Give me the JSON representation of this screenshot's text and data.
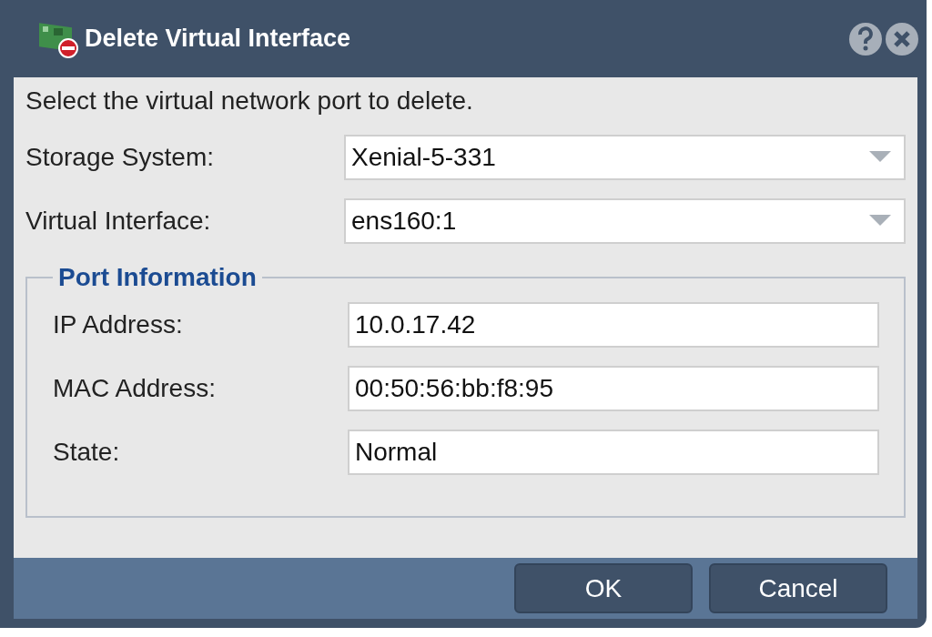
{
  "window": {
    "title": "Delete Virtual Interface"
  },
  "instruction": "Select the virtual network port to delete.",
  "fields": [
    {
      "label": "Storage System:",
      "value": "Xenial-5-331",
      "kind": "dropdown"
    },
    {
      "label": "Virtual Interface:",
      "value": "ens160:1",
      "kind": "dropdown"
    }
  ],
  "port_information": {
    "legend": "Port Information",
    "fields": [
      {
        "label": "IP Address:",
        "value": "10.0.17.42",
        "kind": "text"
      },
      {
        "label": "MAC Address:",
        "value": "00:50:56:bb:f8:95",
        "kind": "text"
      },
      {
        "label": "State:",
        "value": "Normal",
        "kind": "text"
      }
    ]
  },
  "buttons": [
    "OK",
    "Cancel"
  ]
}
